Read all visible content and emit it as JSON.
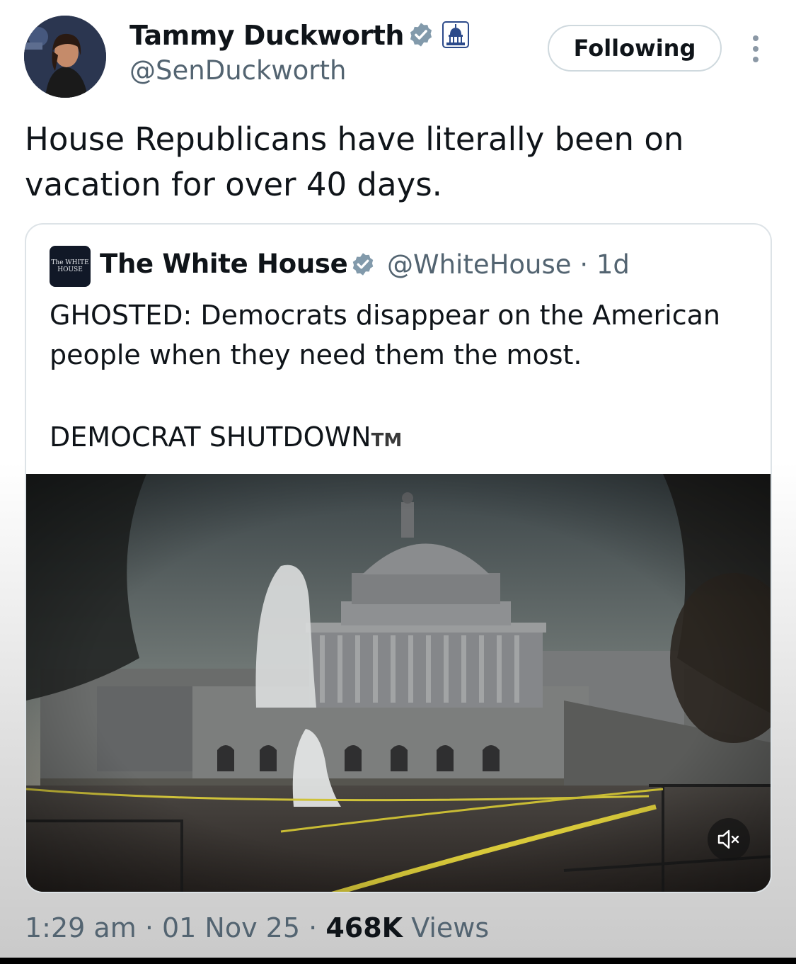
{
  "author": {
    "name": "Tammy Duckworth",
    "handle": "@SenDuckworth",
    "verified_icon": "verified-badge-icon",
    "affiliation_icon": "us-government-capitol-icon"
  },
  "follow_button_label": "Following",
  "tweet_text": "House Republicans have literally been on vacation for over 40 days.",
  "quoted": {
    "avatar_text": "The WHITE HOUSE",
    "name": "The White House",
    "handle": "@WhiteHouse",
    "separator": "·",
    "age": "1d",
    "text_line": "GHOSTED: Democrats disappear on the American people when they need them the most.",
    "text_caps": "DEMOCRAT SHUTDOWN",
    "tm": "TM",
    "media": {
      "description_icon": "capitol-ghosts-video",
      "mute_icon": "speaker-muted-icon"
    }
  },
  "meta": {
    "time": "1:29 am",
    "date": "01 Nov 25",
    "dot": "·",
    "views_count": "468K",
    "views_label": "Views"
  },
  "colors": {
    "text_primary": "#0f1419",
    "text_secondary": "#536471",
    "verified": "#829aab",
    "border": "#cfd9de"
  }
}
